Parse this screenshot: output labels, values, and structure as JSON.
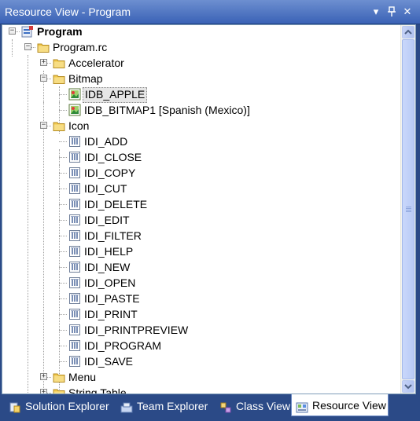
{
  "window": {
    "title": "Resource View - Program",
    "menu_glyph": "▾",
    "pin_glyph": "⊥",
    "close_glyph": "✕"
  },
  "tree": {
    "root": "Program",
    "rc_file": "Program.rc",
    "folders": {
      "accelerator": "Accelerator",
      "bitmap": "Bitmap",
      "icon": "Icon",
      "menu": "Menu",
      "string_table": "String Table"
    },
    "bitmaps": [
      "IDB_APPLE",
      "IDB_BITMAP1 [Spanish (Mexico)]"
    ],
    "icons": [
      "IDI_ADD",
      "IDI_CLOSE",
      "IDI_COPY",
      "IDI_CUT",
      "IDI_DELETE",
      "IDI_EDIT",
      "IDI_FILTER",
      "IDI_HELP",
      "IDI_NEW",
      "IDI_OPEN",
      "IDI_PASTE",
      "IDI_PRINT",
      "IDI_PRINTPREVIEW",
      "IDI_PROGRAM",
      "IDI_SAVE"
    ],
    "selected_item": "IDB_APPLE"
  },
  "tabs": [
    "Solution Explorer",
    "Team Explorer",
    "Class View",
    "Resource View"
  ],
  "active_tab": "Resource View",
  "colors": {
    "title_bar": "#3a62b6",
    "tab_bar": "#2b4a87",
    "folder": "#f2c94c",
    "selection": "#e6e6e6"
  }
}
